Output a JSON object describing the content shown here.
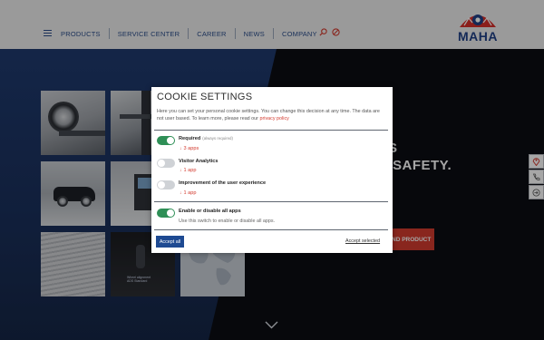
{
  "header": {
    "nav": [
      "PRODUCTS",
      "SERVICE CENTER",
      "CAREER",
      "NEWS",
      "COMPANY"
    ],
    "logo_text": "MAHA",
    "icons": [
      "hamburger-icon",
      "search-icon",
      "globe-icon"
    ]
  },
  "hero": {
    "tagline_line1": "S",
    "tagline_line2": "SAFETY.",
    "button_label": "ND PRODUCT",
    "tile_caption_line1": "Wheel alignment",
    "tile_caption_line2": "ADS Standard",
    "side_icons": [
      "location-pin-icon",
      "phone-icon",
      "login-icon"
    ]
  },
  "cookie_modal": {
    "title": "COOKIE SETTINGS",
    "description": "Here you can set your personal cookie settings. You can change this decision at any time. The data are not user based. To learn more, please read our",
    "policy_link": "privacy policy",
    "categories": [
      {
        "label": "Required",
        "sub": "(always required)",
        "apps": "3 apps",
        "enabled": true
      },
      {
        "label": "Visitor Analytics",
        "apps": "1 app",
        "enabled": false
      },
      {
        "label": "Improvement of the user experience",
        "apps": "1 app",
        "enabled": false
      }
    ],
    "toggle_all": {
      "label": "Enable or disable all apps",
      "description": "Use this switch to enable or disable all apps.",
      "enabled": true
    },
    "accept_all": "Accept all",
    "accept_selected": "Accept selected"
  },
  "colors": {
    "brand_blue": "#1e4a92",
    "accent_red": "#d33b2f",
    "toggle_on": "#2e8f56"
  }
}
